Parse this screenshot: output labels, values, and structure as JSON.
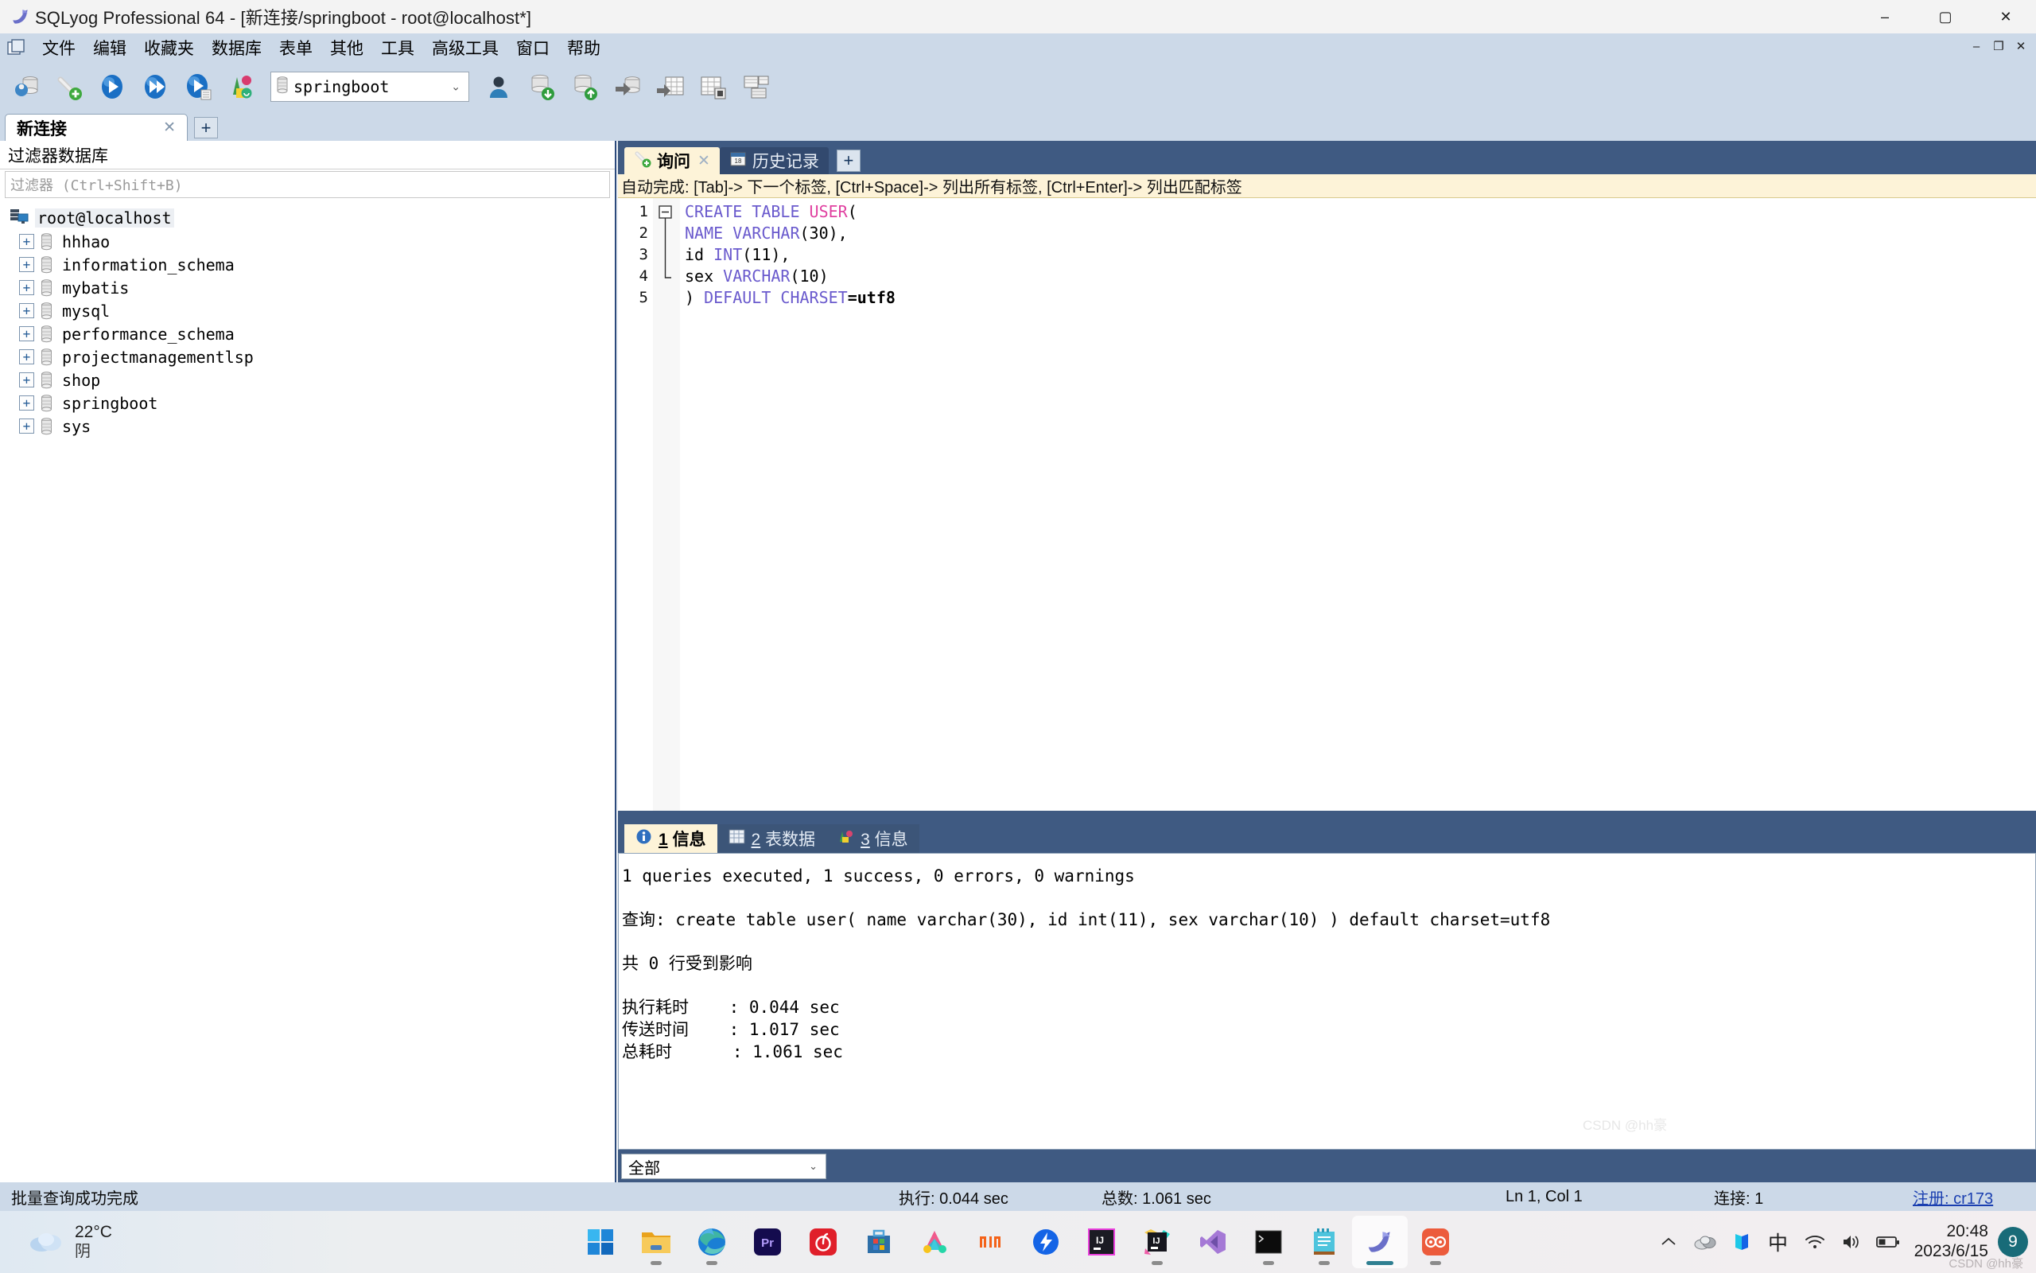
{
  "window": {
    "title": "SQLyog Professional 64 - [新连接/springboot - root@localhost*]",
    "app_icon": "dolphin-icon",
    "minimize": "–",
    "maximize": "▢",
    "close": "✕"
  },
  "menubar": {
    "mdi_icon": "mdi-window-icon",
    "items": [
      {
        "label": "文件",
        "name": "menu-file"
      },
      {
        "label": "编辑",
        "name": "menu-edit"
      },
      {
        "label": "收藏夹",
        "name": "menu-favorites"
      },
      {
        "label": "数据库",
        "name": "menu-database"
      },
      {
        "label": "表单",
        "name": "menu-table"
      },
      {
        "label": "其他",
        "name": "menu-other"
      },
      {
        "label": "工具",
        "name": "menu-tools"
      },
      {
        "label": "高级工具",
        "name": "menu-powertools"
      },
      {
        "label": "窗口",
        "name": "menu-window"
      },
      {
        "label": "帮助",
        "name": "menu-help"
      }
    ],
    "mdi_buttons": [
      "–",
      "❐",
      "✕"
    ]
  },
  "toolbar": {
    "buttons": [
      {
        "name": "new-connection-icon",
        "title": "新连接"
      },
      {
        "name": "add-connection-icon",
        "title": "新建连接"
      },
      {
        "name": "execute-query-icon",
        "title": "执行查询"
      },
      {
        "name": "execute-all-icon",
        "title": "执行全部"
      },
      {
        "name": "execute-to-file-icon",
        "title": "执行并保存"
      },
      {
        "name": "sql-formatter-icon",
        "title": "SQL格式化"
      }
    ],
    "db_selector": {
      "icon": "database-cylinder-icon",
      "value": "springboot",
      "caret": "⌄"
    },
    "buttons_right": [
      {
        "name": "user-manager-icon",
        "title": "用户管理"
      },
      {
        "name": "import-database-icon",
        "title": "导入"
      },
      {
        "name": "export-database-icon",
        "title": "导出"
      },
      {
        "name": "backup-database-icon",
        "title": "备份"
      },
      {
        "name": "import-table-icon",
        "title": "导入表"
      },
      {
        "name": "export-table-icon",
        "title": "导出表"
      },
      {
        "name": "schema-designer-icon",
        "title": "模式设计"
      }
    ]
  },
  "connection_tabs": {
    "tabs": [
      {
        "label": "新连接",
        "close": "✕",
        "active": true
      }
    ],
    "add_label": "+"
  },
  "sidebar": {
    "filter_title": "过滤器数据库",
    "filter_placeholder": "过滤器 (Ctrl+Shift+B)",
    "root": {
      "label": "root@localhost",
      "icon": "server-icon"
    },
    "databases": [
      {
        "label": "hhhao",
        "expander": "+"
      },
      {
        "label": "information_schema",
        "expander": "+"
      },
      {
        "label": "mybatis",
        "expander": "+"
      },
      {
        "label": "mysql",
        "expander": "+"
      },
      {
        "label": "performance_schema",
        "expander": "+"
      },
      {
        "label": "projectmanagementlsp",
        "expander": "+"
      },
      {
        "label": "shop",
        "expander": "+"
      },
      {
        "label": "springboot",
        "expander": "+"
      },
      {
        "label": "sys",
        "expander": "+"
      }
    ]
  },
  "editor": {
    "tabs": [
      {
        "label": "询问",
        "icon": "query-icon",
        "active": true,
        "close": "✕"
      },
      {
        "label": "历史记录",
        "icon": "calendar-icon",
        "active": false
      }
    ],
    "add_label": "+",
    "autocomplete_hint": "自动完成: [Tab]-> 下一个标签, [Ctrl+Space]-> 列出所有标签, [Ctrl+Enter]-> 列出匹配标签",
    "gutter": [
      "1",
      "2",
      "3",
      "4",
      "5"
    ],
    "fold_marker": "–",
    "lines": [
      {
        "n": 1,
        "tokens": [
          {
            "t": "CREATE TABLE ",
            "c": "kw"
          },
          {
            "t": "USER",
            "c": "tbl"
          },
          {
            "t": "(",
            "c": "pun"
          }
        ]
      },
      {
        "n": 2,
        "tokens": [
          {
            "t": "NAME VARCHAR",
            "c": "kw"
          },
          {
            "t": "(30),",
            "c": "pun"
          }
        ]
      },
      {
        "n": 3,
        "tokens": [
          {
            "t": "id ",
            "c": "pun"
          },
          {
            "t": "INT",
            "c": "kw"
          },
          {
            "t": "(11),",
            "c": "pun"
          }
        ]
      },
      {
        "n": 4,
        "tokens": [
          {
            "t": "sex ",
            "c": "pun"
          },
          {
            "t": "VARCHAR",
            "c": "kw"
          },
          {
            "t": "(10)",
            "c": "pun"
          }
        ]
      },
      {
        "n": 5,
        "tokens": [
          {
            "t": ") ",
            "c": "pun"
          },
          {
            "t": "DEFAULT CHARSET",
            "c": "kw"
          },
          {
            "t": "=",
            "c": "bold-black"
          },
          {
            "t": "utf8",
            "c": "bold-black"
          }
        ]
      }
    ]
  },
  "results": {
    "tabs": [
      {
        "num": "1",
        "label": "信息",
        "icon": "info-icon",
        "active": true
      },
      {
        "num": "2",
        "label": "表数据",
        "icon": "grid-icon",
        "active": false
      },
      {
        "num": "3",
        "label": "信息",
        "icon": "chart-icon",
        "active": false
      }
    ],
    "lines": [
      "1 queries executed, 1 success, 0 errors, 0 warnings",
      "",
      "查询: create table user( name varchar(30), id int(11), sex varchar(10) ) default charset=utf8",
      "",
      "共 0 行受到影响",
      "",
      "执行耗时    : 0.044 sec",
      "传送时间    : 1.017 sec",
      "总耗时      : 1.061 sec"
    ],
    "filter_select": {
      "value": "全部",
      "caret": "⌄"
    }
  },
  "statusbar": {
    "message": "批量查询成功完成",
    "exec_time": "执行: 0.044 sec",
    "total_time": "总数: 1.061 sec",
    "cursor": "Ln 1, Col 1",
    "connections": "连接: 1",
    "register_link": "注册: cr173"
  },
  "taskbar": {
    "weather": {
      "temperature": "22°C",
      "condition": "阴",
      "icon": "cloud-icon"
    },
    "apps": [
      {
        "name": "start-button",
        "icon": "windows-logo-icon",
        "running": false
      },
      {
        "name": "file-explorer",
        "icon": "folder-icon",
        "running": true
      },
      {
        "name": "microsoft-edge",
        "icon": "edge-icon",
        "running": true
      },
      {
        "name": "premiere-pro",
        "icon": "premiere-icon",
        "running": false
      },
      {
        "name": "netease-music",
        "icon": "netease-music-icon",
        "running": false
      },
      {
        "name": "microsoft-store",
        "icon": "store-icon",
        "running": false
      },
      {
        "name": "wps-office",
        "icon": "wps-icon",
        "running": false
      },
      {
        "name": "xiaomi",
        "icon": "mi-icon",
        "running": false
      },
      {
        "name": "thunder-download",
        "icon": "thunder-icon",
        "running": false
      },
      {
        "name": "intellij-idea",
        "icon": "intellij-idea-icon",
        "running": false
      },
      {
        "name": "intellij-toolbox",
        "icon": "jetbrains-toolbox-icon",
        "running": true
      },
      {
        "name": "visual-studio",
        "icon": "visual-studio-icon",
        "running": false
      },
      {
        "name": "terminal",
        "icon": "terminal-icon",
        "running": true
      },
      {
        "name": "notepad",
        "icon": "notepad-icon",
        "running": true
      },
      {
        "name": "sqlyog",
        "icon": "dolphin-icon",
        "running": true,
        "focused": true
      },
      {
        "name": "browser-app",
        "icon": "owl-icon",
        "running": true
      }
    ],
    "tray": {
      "chevron": "⌃",
      "icons": [
        "onedrive-icon",
        "app-tray-icon",
        "ime-icon",
        "wifi-icon",
        "volume-icon",
        "battery-icon"
      ],
      "ime_label": "中",
      "time": "20:48",
      "date": "2023/6/15",
      "notification_count": "9"
    },
    "watermark": "CSDN @hh豪"
  },
  "colors": {
    "chrome": "#ccd9e8",
    "panel_blue": "#3f5a82",
    "tab_active": "#fdf3d8",
    "accent": "#2c4a7c"
  }
}
